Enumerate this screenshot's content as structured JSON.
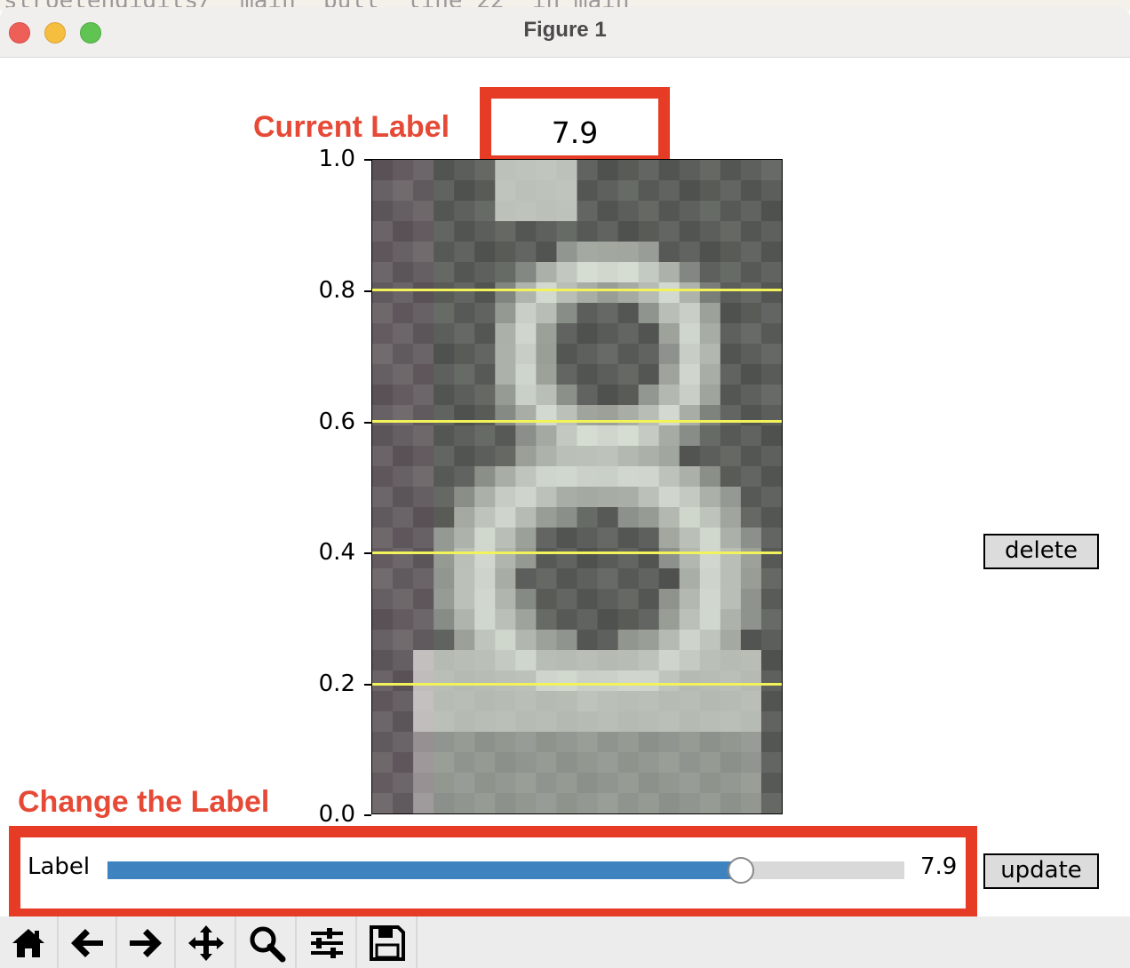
{
  "window": {
    "title": "Figure 1"
  },
  "annotations": {
    "current_label_caption": "Current Label",
    "change_label_caption": "Change the Label"
  },
  "current_label_value": "7.9",
  "y_axis": {
    "ticks": [
      "0.0",
      "0.2",
      "0.4",
      "0.6",
      "0.8",
      "1.0"
    ],
    "range": [
      0,
      1
    ]
  },
  "horizontal_lines": [
    0.2,
    0.4,
    0.6,
    0.8
  ],
  "slider": {
    "label": "Label",
    "value": "7.9",
    "fill_fraction": 0.795
  },
  "buttons": {
    "delete": "delete",
    "update": "update"
  },
  "toolbar": [
    "home-icon",
    "back-arrow-icon",
    "forward-arrow-icon",
    "pan-icon",
    "zoom-icon",
    "configure-subplots-icon",
    "save-icon"
  ],
  "colors": {
    "annotation_red": "#e63b24",
    "line_yellow": "#f2f25a",
    "slider_blue": "#3e82bf"
  }
}
